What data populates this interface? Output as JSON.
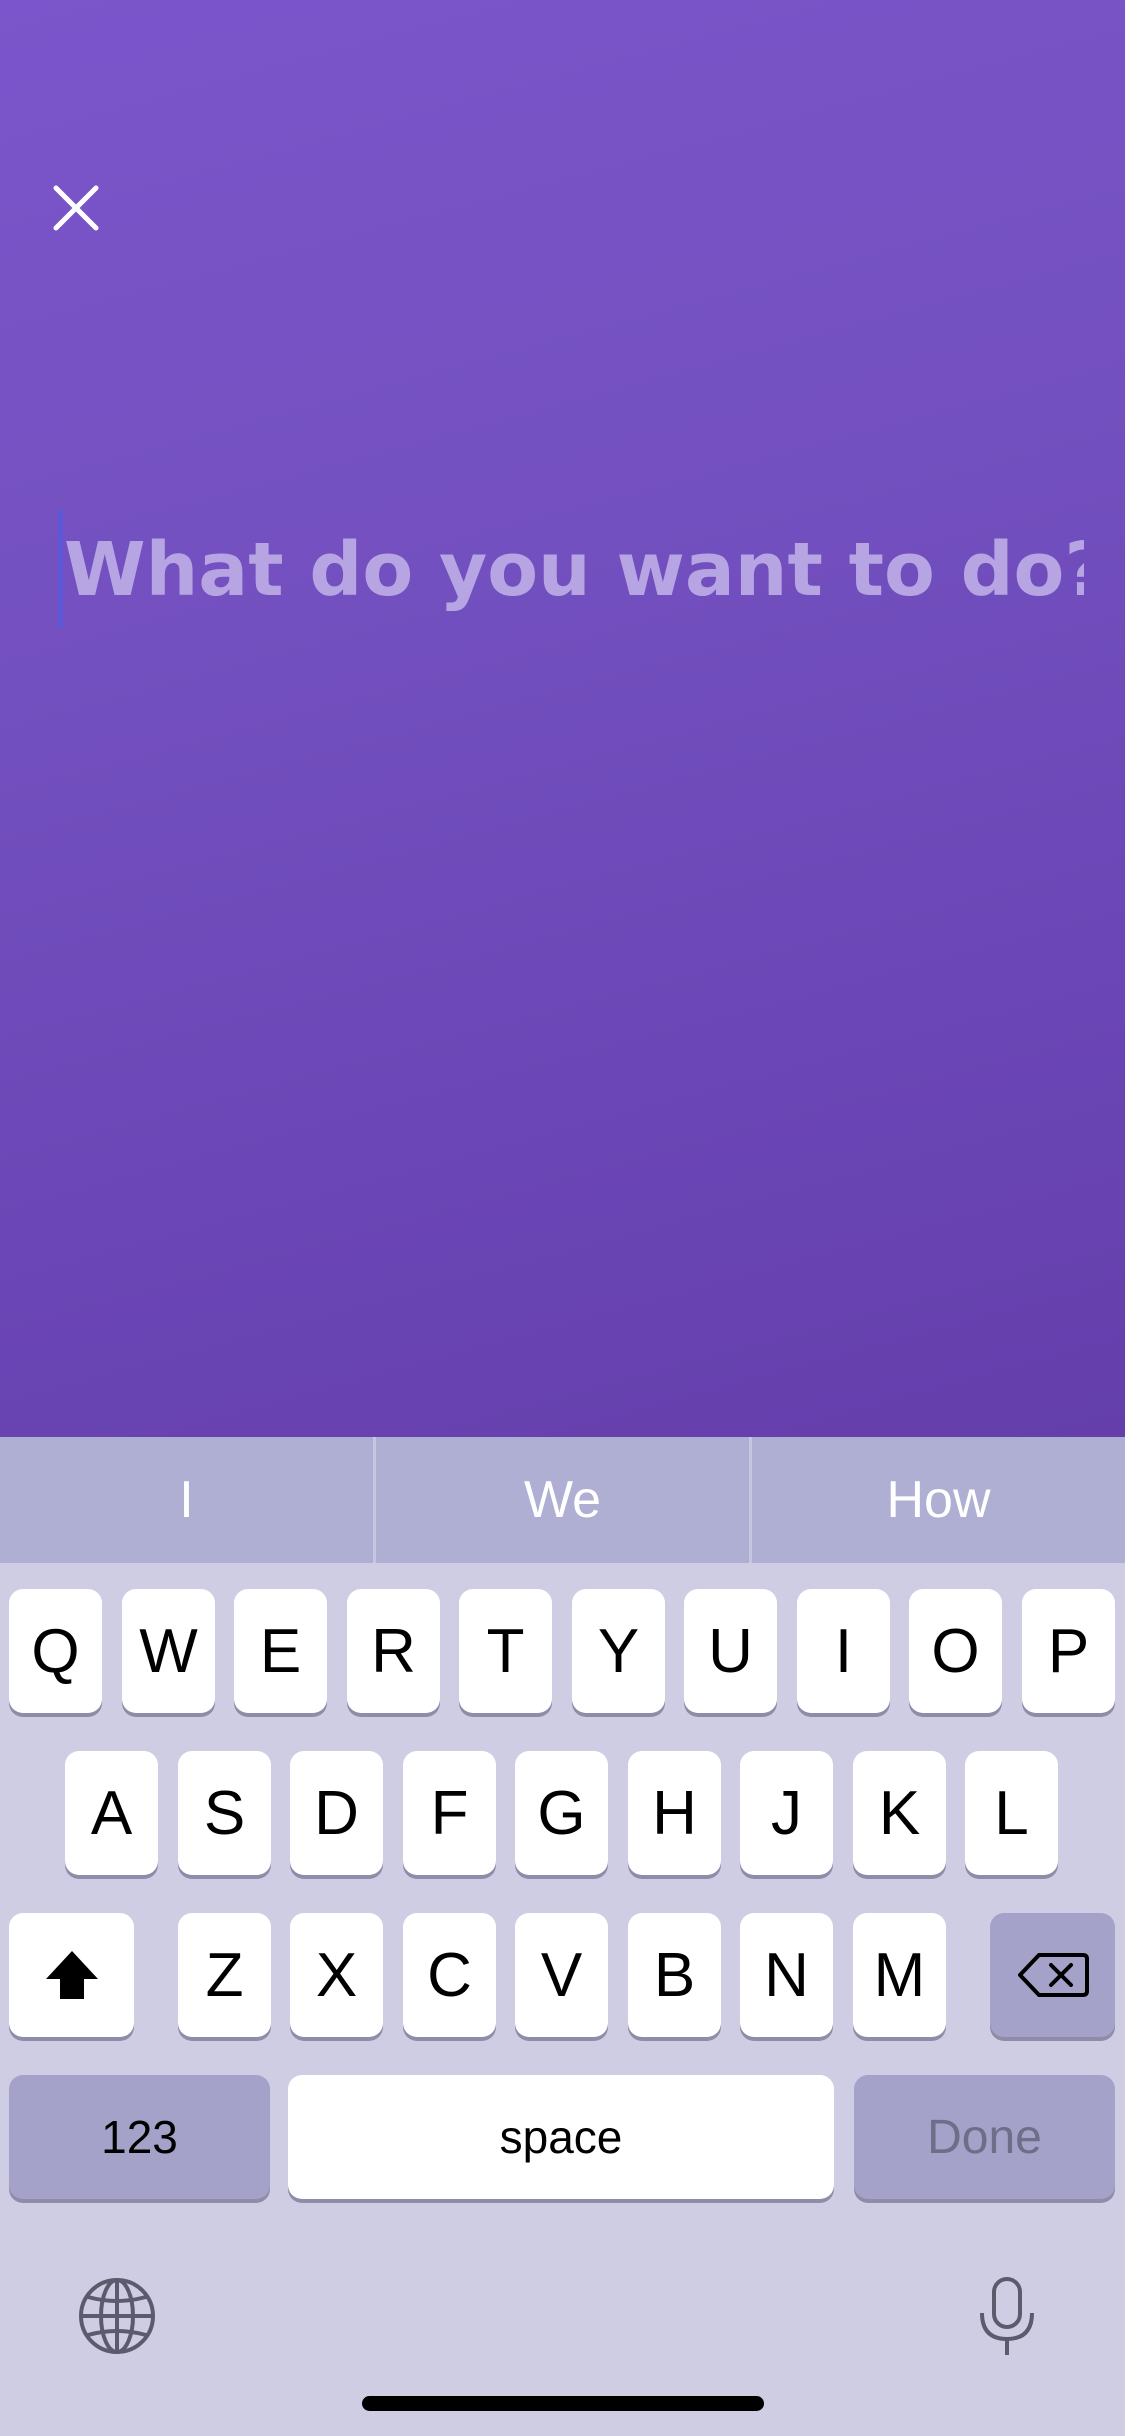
{
  "prompt": {
    "placeholder": "What do you want to do?",
    "value": ""
  },
  "suggestions": [
    "I",
    "We",
    "How"
  ],
  "keyboard": {
    "row1": [
      "Q",
      "W",
      "E",
      "R",
      "T",
      "Y",
      "U",
      "I",
      "O",
      "P"
    ],
    "row2": [
      "A",
      "S",
      "D",
      "F",
      "G",
      "H",
      "J",
      "K",
      "L"
    ],
    "row3": [
      "Z",
      "X",
      "C",
      "V",
      "B",
      "N",
      "M"
    ],
    "numbers_label": "123",
    "space_label": "space",
    "done_label": "Done"
  },
  "icons": {
    "close": "close-icon",
    "shift": "shift-icon",
    "backspace": "backspace-icon",
    "globe": "globe-icon",
    "mic": "microphone-icon"
  },
  "colors": {
    "background_top": "#7b55cb",
    "background_bottom": "#643fab",
    "placeholder": "#b7a5e3",
    "keyboard_bg": "#cfcde3",
    "suggest_bar_bg": "#afaed3"
  }
}
